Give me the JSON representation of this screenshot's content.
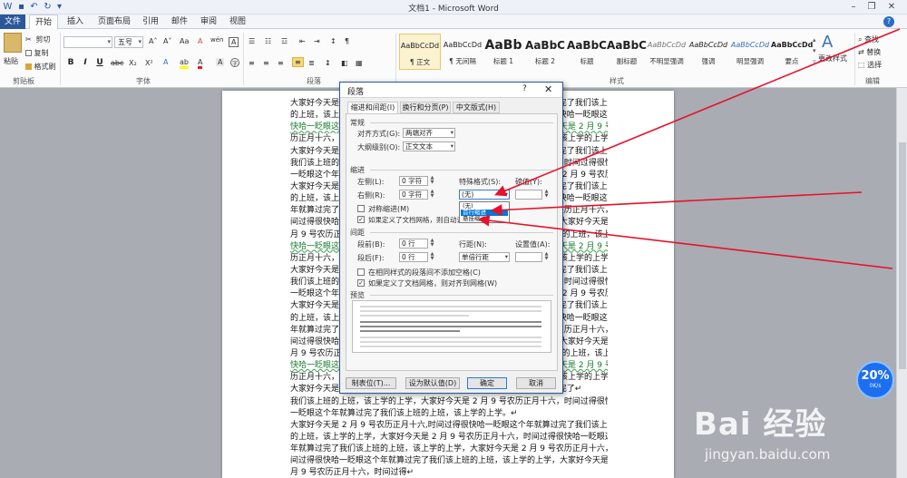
{
  "window": {
    "title": "文档1 - Microsoft Word",
    "help_icon": "?"
  },
  "tabs": [
    "文件",
    "开始",
    "插入",
    "页面布局",
    "引用",
    "邮件",
    "审阅",
    "视图"
  ],
  "ribbon": {
    "clipboard": {
      "paste": "粘贴",
      "cut": "剪切",
      "copy": "复制",
      "format_painter": "格式刷",
      "group_label": "剪贴板"
    },
    "font": {
      "font_name": "",
      "font_size": "五号",
      "group_label": "字体",
      "bold": "B",
      "italic": "I",
      "underline": "U",
      "strike": "abc",
      "subscript": "X₂",
      "superscript": "X²",
      "grow": "A˄",
      "shrink": "A˅",
      "case": "Aa",
      "clear": "A",
      "phonetic": "wén",
      "border": "A"
    },
    "paragraph": {
      "group_label": "段落"
    },
    "styles": {
      "group_label": "样式",
      "items": [
        {
          "sample": "AaBbCcDd",
          "name": "¶ 正文"
        },
        {
          "sample": "AaBbCcDd",
          "name": "¶ 无间隔"
        },
        {
          "sample": "AaBb",
          "name": "标题 1"
        },
        {
          "sample": "AaBbC",
          "name": "标题 2"
        },
        {
          "sample": "AaBbC",
          "name": "标题"
        },
        {
          "sample": "AaBbC",
          "name": "副标题"
        },
        {
          "sample": "AaBbCcDd",
          "name": "不明显强调"
        },
        {
          "sample": "AaBbCcDd",
          "name": "强调"
        },
        {
          "sample": "AaBbCcDd",
          "name": "明显强调"
        },
        {
          "sample": "AaBbCcDd",
          "name": "要点"
        }
      ],
      "change_styles": "更改样式"
    },
    "editing": {
      "find": "查找",
      "replace": "替换",
      "select": "选择",
      "group_label": "编辑"
    }
  },
  "document": {
    "lines": [
      "大家好今天是 2 月 9 号农历正月十六,时间过得很快哈一眨眼这个年就算过完了我们该上班",
      "的上班，该上学的上学，大家好今天是 2 月 9 号农历正月十六,时间过得很快哈一眨眼这个",
      "快哈一眨眼这个年就算过完了我们该上班的上班，该上学的上学，大家好今天是 2 月 9 号农",
      "历正月十六，时间过得很快哈一眨眼这个年就算过完了我们该上班的上班，该上学的上学，",
      "大家好今天是 2 月 9 号农历正月十六,时间过得很快哈一眨眼这个年就算过完了我们该上班↵",
      "我们该上班的上班，该上学的上学，大家好今天是 2 月 9 号农历正月十六，时间过得很快哈",
      "一眨眼这个年就算过完了我们该上班的上班，该上学的上学，大家好今天是 2 月 9 号农历正",
      "大家好今天是 2 月 9 号农历正月十六,时间过得很快哈一眨眼这个年就算过完了我们该上班",
      "的上班，该上学的上学，大家好今天是 2 月 9 号农历正月十六,时间过得很快哈一眨眼这个",
      "年就算过完了我们该上班的上班，该上学的上学，大家好今天是 2 月 9 号农历正月十六，时",
      "间过得很快哈一眨眼这个年就算过完了我们该上班的上班，该上学的上学，大家好今天是 2",
      "月 9 号农历正月十六，时间过得很快哈一眨眼这个年就算过完了我们该上班的上班，该上学",
      "快哈一眨眼这个年就算过完了我们该上班的上班，该上学的上学，大家好今天是 2 月 9 号农",
      "历正月十六，时间过得很快哈一眨眼这个年就算过完了我们该上班的上班，该上学的上学，",
      "大家好今天是 2 月 9 号农历正月十六,时间过得很快哈一眨眼这个年就算过完了我们该上班↵",
      "我们该上班的上班，该上学的上学，大家好今天是 2 月 9 号农历正月十六，时间过得很快哈",
      "一眨眼这个年就算过完了我们该上班的上班，该上学的上学，大家好今天是 2 月 9 号农历正",
      "大家好今天是 2 月 9 号农历正月十六,时间过得很快哈一眨眼这个年就算过完了我们该上班",
      "的上班，该上学的上学，大家好今天是 2 月 9 号农历正月十六,时间过得很快哈一眨眼这个",
      "年就算过完了我们该上班的上班，该上学的上学，大家好今天是 2 月 9 号农历正月十六，时",
      "间过得很快哈一眨眼这个年就算过完了我们该上班的上班，该上学的上学，大家好今天是 2",
      "月 9 号农历正月十六，时间过得很快哈一眨眼这个年就算过完了我们该上班的上班，该上学",
      "快哈一眨眼这个年就算过完了我们该上班的上班，该上学的上学，大家好今天是 2 月 9 号农",
      "历正月十六，时间过得很快哈一眨眼这个年就算过完了我们该上班的上班，该上学的上学，",
      "大家好今天是 2 月 9 号农历正月十六,时间过得很快哈一眨眼这个年就算过完了↵",
      "我们该上班的上班，该上学的上学，大家好今天是 2 月 9 号农历正月十六，时间过得很快哈",
      "一眨眼这个年就算过完了我们该上班的上班，该上学的上学。↵",
      "大家好今天是 2 月 9 号农历正月十六,时间过得很快哈一眨眼这个年就算过完了我们该上班",
      "的上班，该上学的上学，大家好今天是 2 月 9 号农历正月十六，时间过得很快哈一眨眼这个",
      "年就算过完了我们该上班的上班，该上学的上学，大家好今天是 2 月 9 号农历正月十六，时",
      "间过得很快哈一眨眼这个年就算过完了我们该上班的上班，该上学的上学，大家好今天是 2",
      "月 9 号农历正月十六，时间过得↵"
    ],
    "link_lines": [
      2,
      12,
      22
    ]
  },
  "dialog": {
    "title": "段落",
    "help": "?",
    "close": "✕",
    "tabs": [
      "缩进和间距(I)",
      "换行和分页(P)",
      "中文版式(H)"
    ],
    "general": {
      "section": "常规",
      "align_label": "对齐方式(G):",
      "align_value": "两端对齐",
      "outline_label": "大纲级别(O):",
      "outline_value": "正文文本"
    },
    "indent": {
      "section": "缩进",
      "left_label": "左侧(L):",
      "left_value": "0 字符",
      "right_label": "右侧(R):",
      "right_value": "0 字符",
      "special_label": "特殊格式(S):",
      "special_value": "(无)",
      "measure_label": "磅值(Y):",
      "measure_value": "",
      "mirror_label": "对称缩进(M)",
      "auto_label": "如果定义了文档网格，则自动调整右缩进(D)"
    },
    "spacing": {
      "section": "间距",
      "before_label": "段前(B):",
      "before_value": "0 行",
      "after_label": "段后(F):",
      "after_value": "0 行",
      "line_label": "行距(N):",
      "line_value": "单倍行距",
      "at_label": "设置值(A):",
      "at_value": "",
      "no_space_label": "在相同样式的段落间不添加空格(C)",
      "snap_label": "如果定义了文档网格，则对齐到网格(W)"
    },
    "preview": {
      "section": "预览"
    },
    "buttons": {
      "tabs": "制表位(T)...",
      "default": "设为默认值(D)",
      "ok": "确定",
      "cancel": "取消"
    },
    "popup_options": [
      "(无)",
      "首行缩进",
      "悬挂缩进"
    ]
  },
  "widget": {
    "percent": "20%",
    "rate": "0K/s"
  },
  "watermark": {
    "logo": "Bai  经验",
    "url": "jingyan.baidu.com"
  },
  "colors": {
    "accent": "#2b579a",
    "arrow": "#e8102a",
    "selection": "#0078d7"
  }
}
